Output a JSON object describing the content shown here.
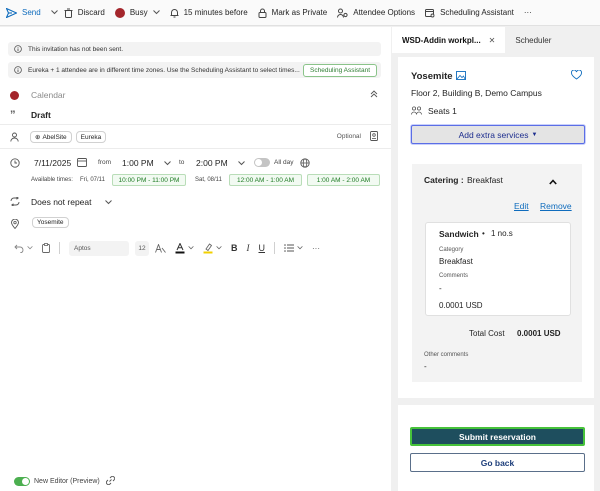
{
  "toolbar": {
    "send": "Send",
    "discard": "Discard",
    "busy": "Busy",
    "reminder": "15 minutes before",
    "private": "Mark as Private",
    "attendee_options": "Attendee Options",
    "scheduling_assistant": "Scheduling Assistant",
    "more": "···"
  },
  "banners": {
    "not_sent": "This invitation has not been sent.",
    "timezone": "Eureka + 1 attendee are in different time zones. Use the Scheduling Assistant to select times...",
    "timezone_button": "Scheduling Assistant"
  },
  "form": {
    "calendar_placeholder": "Calendar",
    "title": "Draft",
    "attendees": [
      "AbelSite",
      "Eureka"
    ],
    "optional_label": "Optional",
    "date": "7/11/2025",
    "from_label": "from",
    "start_time": "1:00 PM",
    "to_label": "to",
    "end_time": "2:00 PM",
    "all_day_label": "All day",
    "available_times_label": "Available times:",
    "available_slots": [
      {
        "day": "Fri, 07/11",
        "range": "10:00 PM - 11:00 PM"
      },
      {
        "day": "Sat, 08/11",
        "range": "12:00 AM - 1:00 AM"
      },
      {
        "day": "",
        "range": "1:00 AM - 2:00 AM"
      }
    ],
    "repeat": "Does not repeat",
    "location": "Yosemite"
  },
  "format_bar": {
    "font": "Aptos",
    "size": "12"
  },
  "footer": {
    "new_editor": "New Editor (Preview)"
  },
  "addin": {
    "tabs": [
      {
        "label": "WSD-Addin workpl...",
        "active": true
      },
      {
        "label": "Scheduler",
        "active": false
      }
    ],
    "room_name": "Yosemite",
    "room_location": "Floor 2, Building B, Demo Campus",
    "seats": "Seats 1",
    "add_services": "Add extra services",
    "catering_label": "Catering :",
    "catering_value": "Breakfast",
    "edit": "Edit",
    "remove": "Remove",
    "item_name": "Sandwich",
    "item_qty": "1 no.s",
    "category_label": "Category",
    "category_value": "Breakfast",
    "comments_label": "Comments",
    "comments_value": "-",
    "item_price": "0.0001 USD",
    "total_label": "Total Cost",
    "total_value": "0.0001 USD",
    "other_comments_label": "Other comments",
    "other_comments_value": "-",
    "submit": "Submit reservation",
    "go_back": "Go back"
  },
  "colors": {
    "accent_blue": "#0f6cbd",
    "submit_bg": "#1e4e5e",
    "submit_border": "#47c23b",
    "busy_red": "#a4262c",
    "slot_green": "#1e7b24"
  }
}
